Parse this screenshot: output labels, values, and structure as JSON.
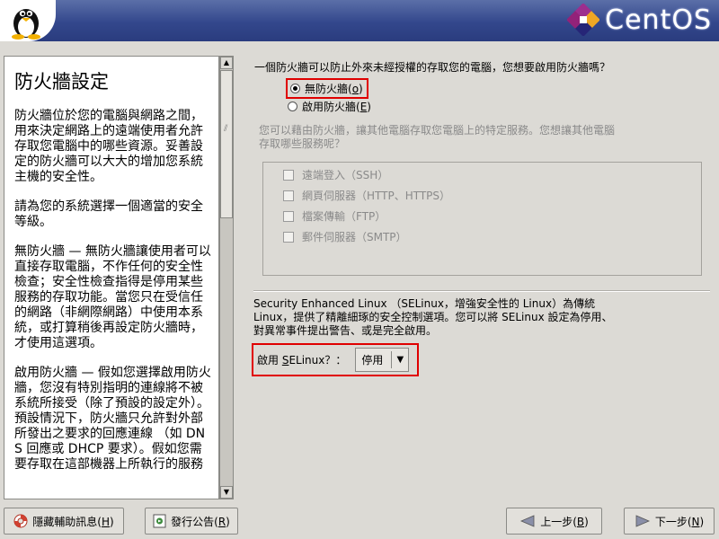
{
  "header": {
    "logo_text": "CentOS",
    "icons": {
      "tux": "tux-penguin-icon",
      "logo": "centos-logo-icon"
    }
  },
  "help": {
    "title": "防火牆設定",
    "paragraphs": [
      "防火牆位於您的電腦與網路之間，用來決定網路上的遠端使用者允許存取您電腦中的哪些資源。妥善設定的防火牆可以大大的增加您系統主機的安全性。",
      "請為您的系統選擇一個適當的安全等級。",
      "無防火牆 — 無防火牆讓使用者可以直接存取電腦，不作任何的安全性檢查；安全性檢查指得是停用某些服務的存取功能。當您只在受信任的網路（非網際網路）中使用本系統，或打算稍後再設定防火牆時，才使用這選項。",
      "啟用防火牆 — 假如您選擇啟用防火牆，您沒有特別指明的連線將不被系統所接受（除了預設的設定外）。預設情況下，防火牆只允許對外部所發出之要求的回應連線 （如 DNS 回應或 DHCP 要求）。假如您需要存取在這部機器上所執行的服務"
    ]
  },
  "firewall": {
    "question": "一個防火牆可以防止外來未經授權的存取您的電腦，您想要啟用防火牆嗎？",
    "options": [
      {
        "label": "無防火牆",
        "mnemonic": "o",
        "checked": true
      },
      {
        "label": "啟用防火牆",
        "mnemonic": "E",
        "checked": false
      }
    ],
    "description": "您可以藉由防火牆，讓其他電腦存取您電腦上的特定服務。您想讓其他電腦存取哪些服務呢？",
    "services": [
      {
        "label": "遠端登入（SSH）",
        "checked": false
      },
      {
        "label": "網頁伺服器（HTTP、HTTPS）",
        "checked": false
      },
      {
        "label": "檔案傳輸（FTP）",
        "checked": false
      },
      {
        "label": "郵件伺服器（SMTP）",
        "checked": false
      }
    ]
  },
  "selinux": {
    "description": "Security Enhanced Linux （SELinux，增強安全性的 Linux）為傳統 Linux，提供了精離細琢的安全控制選項。您可以將 SELinux 設定為停用、對異常事件提出警告、或是完全啟用。",
    "label_prefix": "啟用 ",
    "label_mnemonic": "S",
    "label_rest": "ELinux？：",
    "selected": "停用"
  },
  "footer": {
    "hide_help": {
      "label": "隱藏輔助訊息(",
      "mnemonic": "H",
      "suffix": ")"
    },
    "release_notes": {
      "label": "發行公告(",
      "mnemonic": "R",
      "suffix": ")"
    },
    "back": {
      "label": "上一步(",
      "mnemonic": "B",
      "suffix": ")"
    },
    "next": {
      "label": "下一步(",
      "mnemonic": "N",
      "suffix": ")"
    }
  }
}
